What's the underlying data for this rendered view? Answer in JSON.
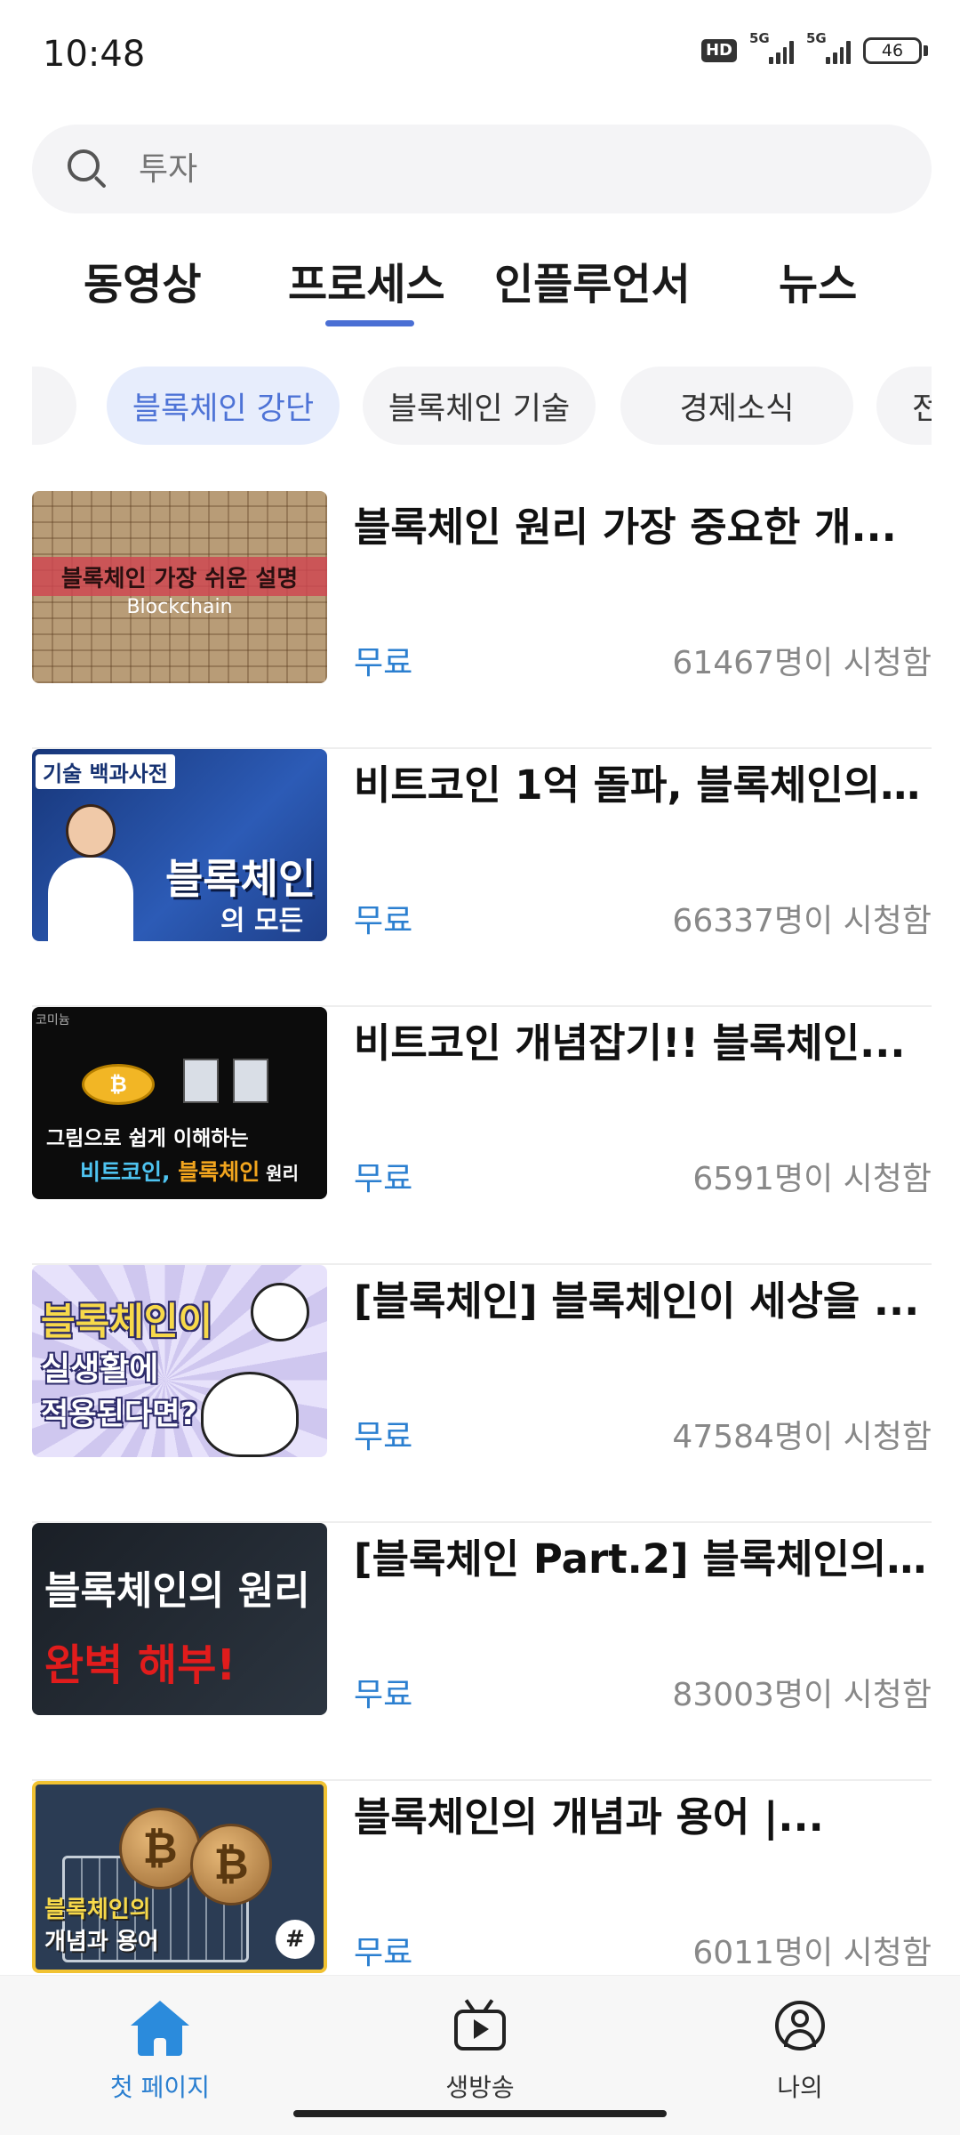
{
  "status_bar": {
    "time": "10:48",
    "hd_label": "HD",
    "signal_1": "5G",
    "signal_2": "5G",
    "battery": "46"
  },
  "search": {
    "placeholder": "투자",
    "icon": "search-icon"
  },
  "tabs": [
    {
      "label": "동영상",
      "active": false
    },
    {
      "label": "프로세스",
      "active": true
    },
    {
      "label": "인플루언서",
      "active": false
    },
    {
      "label": "뉴스",
      "active": false
    }
  ],
  "chips": [
    {
      "label": "",
      "active": false
    },
    {
      "label": "블록체인 강단",
      "active": true
    },
    {
      "label": "블록체인 기술",
      "active": false
    },
    {
      "label": "경제소식",
      "active": false
    },
    {
      "label": "전",
      "active": false
    }
  ],
  "videos": [
    {
      "title": "블록체인 원리 가장 중요한 개...",
      "price": "무료",
      "views": "61467명이 시청함",
      "thumb_text_1": "블록체인 가장 쉬운 설명",
      "thumb_text_2": "Blockchain"
    },
    {
      "title": "비트코인 1억 돌파, 블록체인의 ...",
      "price": "무료",
      "views": "66337명이 시청함",
      "thumb_tag": "기술 백과사전",
      "thumb_big": "블록체인",
      "thumb_small": "의 모든 것"
    },
    {
      "title": "비트코인 개념잡기!! 블록체인...",
      "price": "무료",
      "views": "6591명이 시청함",
      "thumb_corner": "코미늄",
      "thumb_line1": "그림으로 쉽게 이해하는",
      "thumb_line2_a": "비트코인, ",
      "thumb_line2_b": "블록체인",
      "thumb_line2_c": " 원리"
    },
    {
      "title": "[블록체인] 블록체인이 세상을 ...",
      "price": "무료",
      "views": "47584명이 시청함",
      "thumb_a": "블록체인이",
      "thumb_b": "실생활에",
      "thumb_c": "적용된다면?"
    },
    {
      "title": "[블록체인 Part.2] 블록체인의 ...",
      "price": "무료",
      "views": "83003명이 시청함",
      "thumb_a": "블록체인의 원리",
      "thumb_b": "완벽 해부!"
    },
    {
      "title": "블록체인의 개념과 용어 |...",
      "price": "무료",
      "views": "6011명이 시청함",
      "thumb_a": "블록체인의",
      "thumb_b": "개념과 용어"
    }
  ],
  "bottom_nav": [
    {
      "label": "첫 페이지",
      "icon": "home-icon",
      "active": true
    },
    {
      "label": "생방송",
      "icon": "live-tv-icon",
      "active": false
    },
    {
      "label": "나의",
      "icon": "profile-icon",
      "active": false
    }
  ],
  "colors": {
    "accent_blue": "#2b7fd0",
    "tab_indicator": "#4a6fd4",
    "active_chip_bg": "#e7edfc",
    "active_chip_text": "#4e73d6"
  }
}
